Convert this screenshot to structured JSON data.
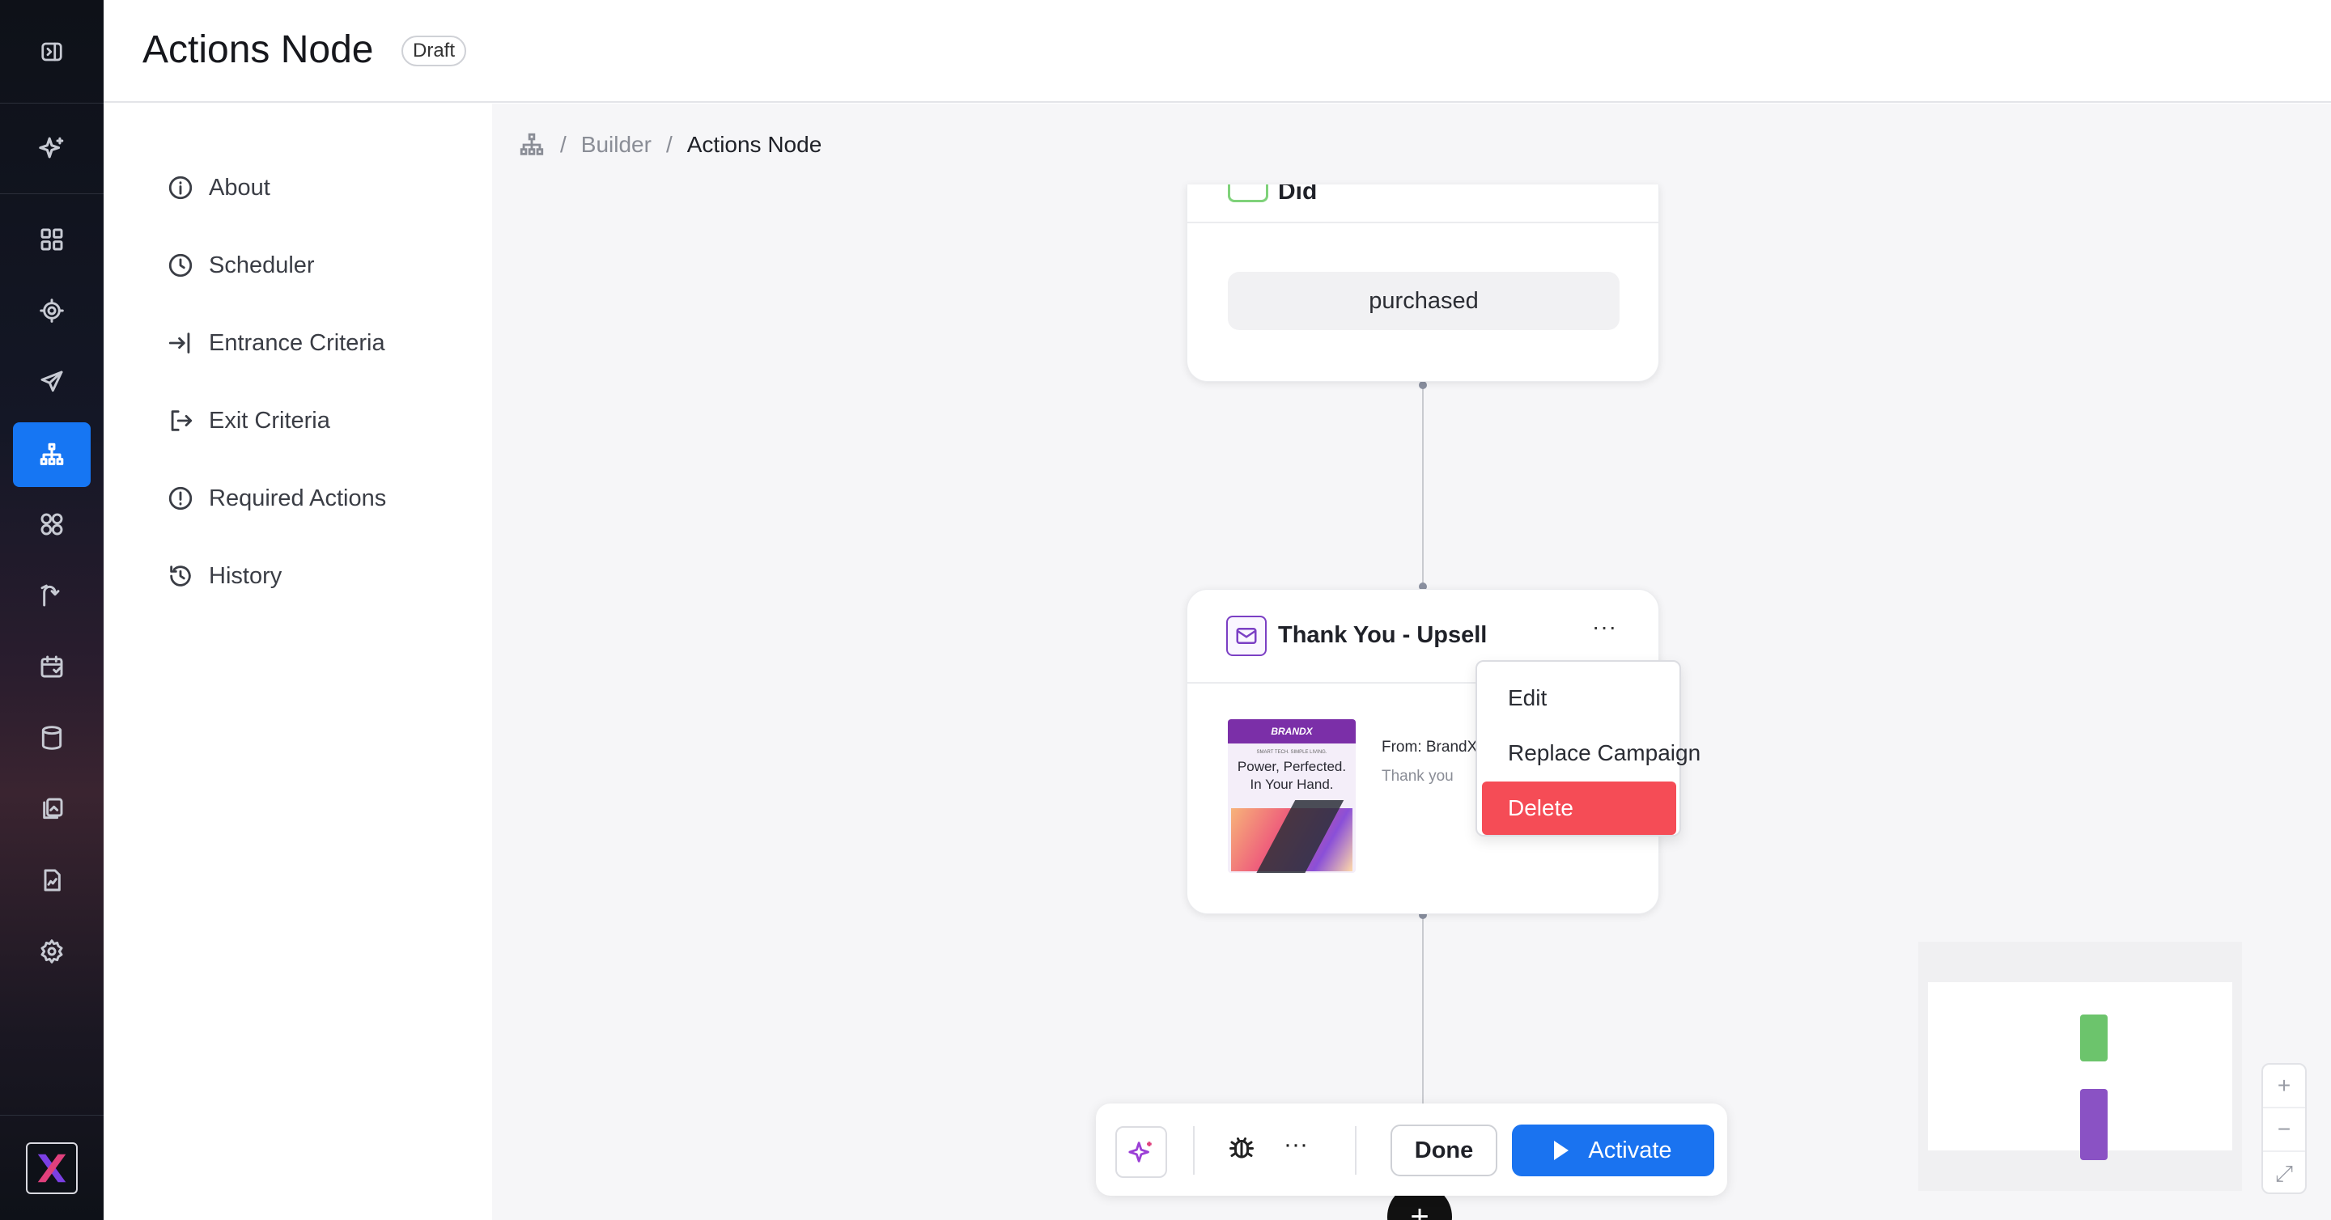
{
  "header": {
    "title": "Actions Node",
    "badge": "Draft"
  },
  "rail": {
    "items": [
      "panel-toggle-icon",
      "ai-sparkle-icon",
      "dashboard-icon",
      "target-icon",
      "send-icon",
      "workflow-icon",
      "segments-icon",
      "journey-icon",
      "calendar-icon",
      "database-icon",
      "assets-icon",
      "reports-icon",
      "settings-icon"
    ],
    "active": "workflow-icon",
    "accent": "#1676f3"
  },
  "settings": {
    "items": [
      {
        "label": "About",
        "icon": "info-icon"
      },
      {
        "label": "Scheduler",
        "icon": "clock-icon"
      },
      {
        "label": "Entrance Criteria",
        "icon": "enter-icon"
      },
      {
        "label": "Exit Criteria",
        "icon": "exit-icon"
      },
      {
        "label": "Required Actions",
        "icon": "alert-icon"
      },
      {
        "label": "History",
        "icon": "history-icon"
      }
    ]
  },
  "breadcrumb": {
    "root": "Builder",
    "current": "Actions Node",
    "sep": "/"
  },
  "node1": {
    "title": "Did",
    "value": "purchased"
  },
  "node2": {
    "title": "Thank You - Upsell",
    "more": "···",
    "thumb": {
      "brand": "BRANDX",
      "tagline": "SMART TECH. SIMPLE LIVING.",
      "headline1": "Power, Perfected.",
      "headline2": "In Your Hand."
    },
    "from": "From: BrandX",
    "subject": "Thank you"
  },
  "menu": {
    "items": [
      "Edit",
      "Replace Campaign",
      "Delete"
    ],
    "danger_color": "#f54c56"
  },
  "toolbar": {
    "more": "···",
    "done": "Done",
    "activate": "Activate",
    "activate_color": "#1a73f0"
  },
  "add": "+",
  "zoom": {
    "in": "+",
    "out": "−",
    "fit": "⤢"
  }
}
